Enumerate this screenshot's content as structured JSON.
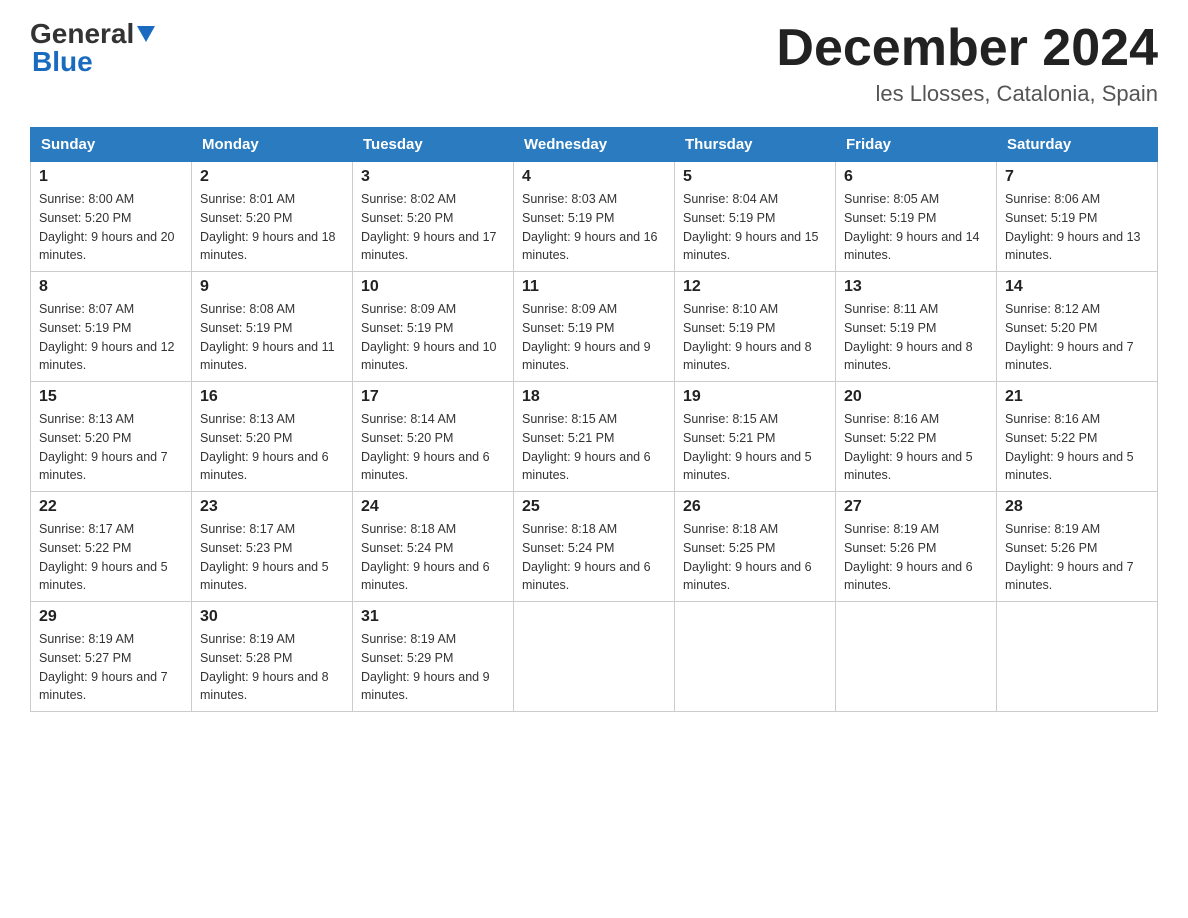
{
  "header": {
    "logo_line1": "General",
    "logo_line2": "Blue",
    "title": "December 2024",
    "subtitle": "les Llosses, Catalonia, Spain"
  },
  "days_of_week": [
    "Sunday",
    "Monday",
    "Tuesday",
    "Wednesday",
    "Thursday",
    "Friday",
    "Saturday"
  ],
  "weeks": [
    [
      {
        "day": "1",
        "sunrise": "8:00 AM",
        "sunset": "5:20 PM",
        "daylight": "9 hours and 20 minutes."
      },
      {
        "day": "2",
        "sunrise": "8:01 AM",
        "sunset": "5:20 PM",
        "daylight": "9 hours and 18 minutes."
      },
      {
        "day": "3",
        "sunrise": "8:02 AM",
        "sunset": "5:20 PM",
        "daylight": "9 hours and 17 minutes."
      },
      {
        "day": "4",
        "sunrise": "8:03 AM",
        "sunset": "5:19 PM",
        "daylight": "9 hours and 16 minutes."
      },
      {
        "day": "5",
        "sunrise": "8:04 AM",
        "sunset": "5:19 PM",
        "daylight": "9 hours and 15 minutes."
      },
      {
        "day": "6",
        "sunrise": "8:05 AM",
        "sunset": "5:19 PM",
        "daylight": "9 hours and 14 minutes."
      },
      {
        "day": "7",
        "sunrise": "8:06 AM",
        "sunset": "5:19 PM",
        "daylight": "9 hours and 13 minutes."
      }
    ],
    [
      {
        "day": "8",
        "sunrise": "8:07 AM",
        "sunset": "5:19 PM",
        "daylight": "9 hours and 12 minutes."
      },
      {
        "day": "9",
        "sunrise": "8:08 AM",
        "sunset": "5:19 PM",
        "daylight": "9 hours and 11 minutes."
      },
      {
        "day": "10",
        "sunrise": "8:09 AM",
        "sunset": "5:19 PM",
        "daylight": "9 hours and 10 minutes."
      },
      {
        "day": "11",
        "sunrise": "8:09 AM",
        "sunset": "5:19 PM",
        "daylight": "9 hours and 9 minutes."
      },
      {
        "day": "12",
        "sunrise": "8:10 AM",
        "sunset": "5:19 PM",
        "daylight": "9 hours and 8 minutes."
      },
      {
        "day": "13",
        "sunrise": "8:11 AM",
        "sunset": "5:19 PM",
        "daylight": "9 hours and 8 minutes."
      },
      {
        "day": "14",
        "sunrise": "8:12 AM",
        "sunset": "5:20 PM",
        "daylight": "9 hours and 7 minutes."
      }
    ],
    [
      {
        "day": "15",
        "sunrise": "8:13 AM",
        "sunset": "5:20 PM",
        "daylight": "9 hours and 7 minutes."
      },
      {
        "day": "16",
        "sunrise": "8:13 AM",
        "sunset": "5:20 PM",
        "daylight": "9 hours and 6 minutes."
      },
      {
        "day": "17",
        "sunrise": "8:14 AM",
        "sunset": "5:20 PM",
        "daylight": "9 hours and 6 minutes."
      },
      {
        "day": "18",
        "sunrise": "8:15 AM",
        "sunset": "5:21 PM",
        "daylight": "9 hours and 6 minutes."
      },
      {
        "day": "19",
        "sunrise": "8:15 AM",
        "sunset": "5:21 PM",
        "daylight": "9 hours and 5 minutes."
      },
      {
        "day": "20",
        "sunrise": "8:16 AM",
        "sunset": "5:22 PM",
        "daylight": "9 hours and 5 minutes."
      },
      {
        "day": "21",
        "sunrise": "8:16 AM",
        "sunset": "5:22 PM",
        "daylight": "9 hours and 5 minutes."
      }
    ],
    [
      {
        "day": "22",
        "sunrise": "8:17 AM",
        "sunset": "5:22 PM",
        "daylight": "9 hours and 5 minutes."
      },
      {
        "day": "23",
        "sunrise": "8:17 AM",
        "sunset": "5:23 PM",
        "daylight": "9 hours and 5 minutes."
      },
      {
        "day": "24",
        "sunrise": "8:18 AM",
        "sunset": "5:24 PM",
        "daylight": "9 hours and 6 minutes."
      },
      {
        "day": "25",
        "sunrise": "8:18 AM",
        "sunset": "5:24 PM",
        "daylight": "9 hours and 6 minutes."
      },
      {
        "day": "26",
        "sunrise": "8:18 AM",
        "sunset": "5:25 PM",
        "daylight": "9 hours and 6 minutes."
      },
      {
        "day": "27",
        "sunrise": "8:19 AM",
        "sunset": "5:26 PM",
        "daylight": "9 hours and 6 minutes."
      },
      {
        "day": "28",
        "sunrise": "8:19 AM",
        "sunset": "5:26 PM",
        "daylight": "9 hours and 7 minutes."
      }
    ],
    [
      {
        "day": "29",
        "sunrise": "8:19 AM",
        "sunset": "5:27 PM",
        "daylight": "9 hours and 7 minutes."
      },
      {
        "day": "30",
        "sunrise": "8:19 AM",
        "sunset": "5:28 PM",
        "daylight": "9 hours and 8 minutes."
      },
      {
        "day": "31",
        "sunrise": "8:19 AM",
        "sunset": "5:29 PM",
        "daylight": "9 hours and 9 minutes."
      },
      null,
      null,
      null,
      null
    ]
  ]
}
